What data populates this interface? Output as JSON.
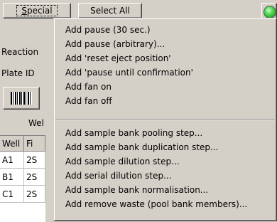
{
  "toolbar": {
    "special_label": "Special",
    "special_accel": "S",
    "select_all_label": "Select All"
  },
  "sidebar": {
    "reaction_label": "Reaction",
    "plate_id_label": "Plate ID",
    "well_header": "Wel"
  },
  "grid": {
    "headers": [
      "Well",
      "Fi"
    ],
    "rows": [
      [
        "A1",
        "2S"
      ],
      [
        "B1",
        "2S"
      ],
      [
        "C1",
        "2S"
      ]
    ]
  },
  "menu": {
    "items": [
      "Add pause (30 sec.)",
      "Add pause (arbitrary)...",
      "Add 'reset eject position'",
      "Add 'pause until confirmation'",
      "Add fan on",
      "Add fan off",
      "Add sample bank pooling step...",
      "Add sample bank duplication step...",
      "Add sample dilution step...",
      "Add serial dilution step...",
      "Add sample bank normalisation...",
      "Add remove waste (pool bank members)..."
    ]
  },
  "colors": {
    "face": "#d4d0c8",
    "status_led": "#44d044"
  }
}
